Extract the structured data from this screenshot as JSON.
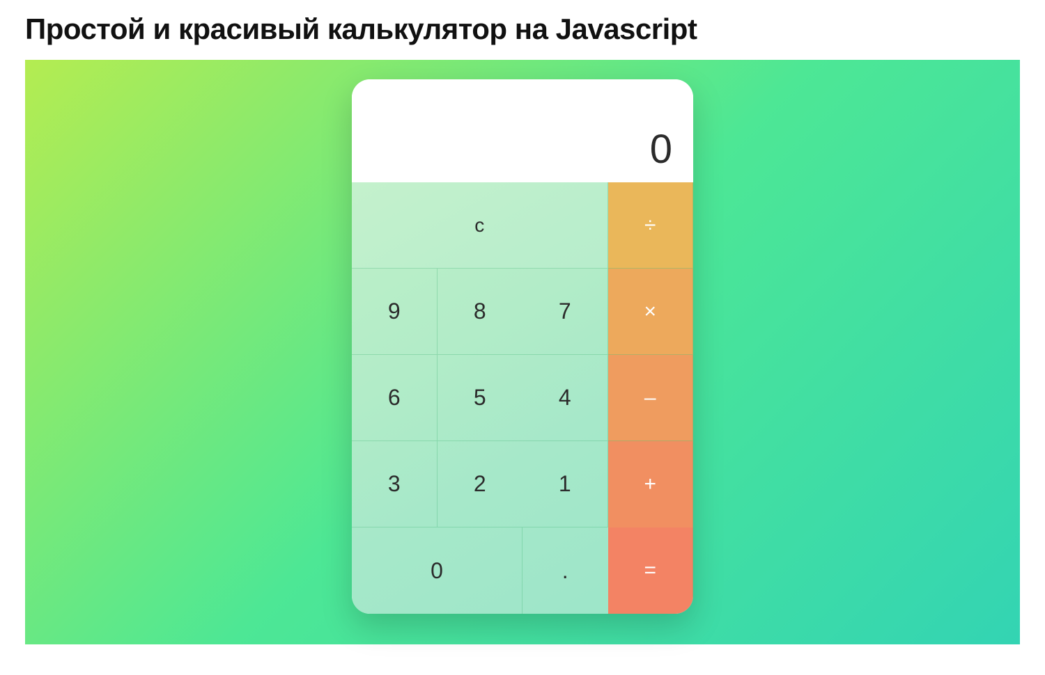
{
  "heading": "Простой и красивый калькулятор на Javascript",
  "calculator": {
    "display_value": "0",
    "keys": {
      "clear": "c",
      "divide": "÷",
      "nine": "9",
      "eight": "8",
      "seven": "7",
      "multiply": "×",
      "six": "6",
      "five": "5",
      "four": "4",
      "minus": "–",
      "three": "3",
      "two": "2",
      "one": "1",
      "plus": "+",
      "zero": "0",
      "dot": ".",
      "equals": "="
    }
  },
  "colors": {
    "bg_gradient_from": "#b4ec51",
    "bg_gradient_mid": "#4de795",
    "bg_gradient_to": "#33d4b3",
    "op_divide": "#eab75a",
    "op_multiply": "#eda95c",
    "op_minus": "#ef9c5f",
    "op_plus": "#f18f61",
    "op_equals": "#f38364"
  }
}
